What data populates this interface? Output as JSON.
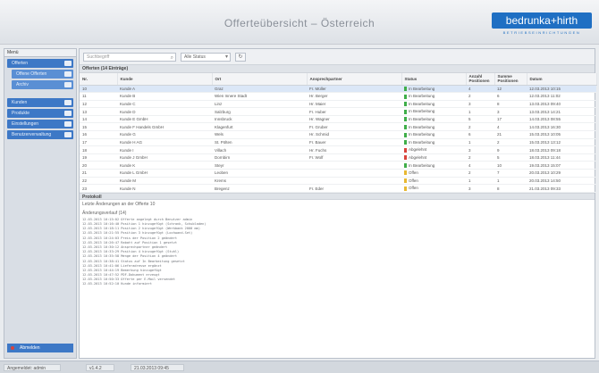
{
  "header": {
    "title": "Offerteübersicht – Österreich",
    "logo_text": "bedrunka+hirth",
    "logo_subtitle": "BETRIEBSEINRICHTUNGEN"
  },
  "sidebar": {
    "header": "Menü",
    "items": [
      {
        "label": "Offerten",
        "sub": false
      },
      {
        "label": "Offene Offerten",
        "sub": true
      },
      {
        "label": "Archiv",
        "sub": true
      },
      {
        "label": "Kunden",
        "sub": false
      },
      {
        "label": "Produkte",
        "sub": false
      },
      {
        "label": "Einstellungen",
        "sub": false
      },
      {
        "label": "Benutzerverwaltung",
        "sub": false
      }
    ],
    "bottom_label": "Abmelden"
  },
  "toolbar": {
    "search_placeholder": "Suchbegriff",
    "select_value": "Alle Status",
    "refresh_label": "↻"
  },
  "table": {
    "title": "Offerten (14 Einträge)",
    "columns": [
      "Nr.",
      "Kunde",
      "Ort",
      "Ansprechpartner",
      "Status",
      "Anzahl Positionen",
      "Summe Positionen",
      "Datum"
    ],
    "rows": [
      [
        "10",
        "Kunde A",
        "Graz",
        "Fr. Müller",
        "In Bearbeitung",
        "4",
        "12",
        "12.03.2013 10:15"
      ],
      [
        "11",
        "Kunde B",
        "Wien Innere Stadt",
        "Hr. Berger",
        "In Bearbeitung",
        "2",
        "6",
        "12.03.2013 11:02"
      ],
      [
        "12",
        "Kunde C",
        "Linz",
        "Hr. Maier",
        "In Bearbeitung",
        "3",
        "8",
        "13.03.2013 09:40"
      ],
      [
        "13",
        "Kunde D",
        "Salzburg",
        "Fr. Huber",
        "In Bearbeitung",
        "1",
        "3",
        "13.03.2013 14:21"
      ],
      [
        "14",
        "Kunde E GmbH",
        "Innsbruck",
        "Hr. Wagner",
        "In Bearbeitung",
        "5",
        "17",
        "14.03.2013 08:55"
      ],
      [
        "15",
        "Kunde F Handels GmbH",
        "Klagenfurt",
        "Fr. Gruber",
        "In Bearbeitung",
        "2",
        "4",
        "14.03.2013 16:30"
      ],
      [
        "16",
        "Kunde G",
        "Wels",
        "Hr. Schmid",
        "In Bearbeitung",
        "6",
        "21",
        "15.03.2013 10:05"
      ],
      [
        "17",
        "Kunde H AG",
        "St. Pölten",
        "Fr. Bauer",
        "In Bearbeitung",
        "1",
        "2",
        "15.03.2013 13:12"
      ],
      [
        "18",
        "Kunde I",
        "Villach",
        "Hr. Fuchs",
        "Abgelehnt",
        "3",
        "9",
        "18.03.2013 09:18"
      ],
      [
        "19",
        "Kunde J GmbH",
        "Dornbirn",
        "Fr. Wolf",
        "Abgelehnt",
        "2",
        "5",
        "18.03.2013 11:44"
      ],
      [
        "20",
        "Kunde K",
        "Steyr",
        "",
        "In Bearbeitung",
        "4",
        "10",
        "19.03.2013 15:07"
      ],
      [
        "21",
        "Kunde L GmbH",
        "Leoben",
        "",
        "Offen",
        "2",
        "7",
        "20.03.2013 10:29"
      ],
      [
        "22",
        "Kunde M",
        "Krems",
        "",
        "Offen",
        "1",
        "1",
        "20.03.2013 14:50"
      ],
      [
        "23",
        "Kunde N",
        "Bregenz",
        "Fr. Eder",
        "Offen",
        "3",
        "8",
        "21.03.2013 09:33"
      ]
    ],
    "status_colors": {
      "In Bearbeitung": "#3fae49",
      "Abgelehnt": "#d9433b",
      "Offen": "#e8b832"
    }
  },
  "log": {
    "title": "Protokoll",
    "subtitle": "Letzte Änderungen an der Offerte 10",
    "subtitle2": "Änderungsverlauf (14)",
    "lines": [
      "12.03.2013 10:15:02  Offerte angelegt durch Benutzer admin",
      "12.03.2013 10:16:40  Position 1 hinzugefügt (Schrank, Schubladen)",
      "12.03.2013 10:18:11  Position 2 hinzugefügt (Werkbank 2000 mm)",
      "12.03.2013 10:21:55  Position 3 hinzugefügt (Lochwand-Set)",
      "12.03.2013 10:24:03  Preis der Position 2 geändert",
      "12.03.2013 10:26:47  Rabatt auf Position 1 gesetzt",
      "12.03.2013 10:30:12  Ansprechpartner geändert",
      "12.03.2013 10:33:29  Position 4 hinzugefügt (Stuhl)",
      "12.03.2013 10:35:58  Menge der Position 4 geändert",
      "12.03.2013 10:38:41  Status auf In Bearbeitung gesetzt",
      "12.03.2013 10:41:06  Lieferadresse ergänzt",
      "12.03.2013 10:44:19  Bemerkung hinzugefügt",
      "12.03.2013 10:47:52  PDF-Dokument erzeugt",
      "12.03.2013 10:50:33  Offerte per E-Mail versendet",
      "12.03.2013 10:52:10  Kunde informiert"
    ]
  },
  "statusbar": {
    "user": "Angemeldet: admin",
    "version": "v1.4.2",
    "date": "21.03.2013 09:45"
  }
}
